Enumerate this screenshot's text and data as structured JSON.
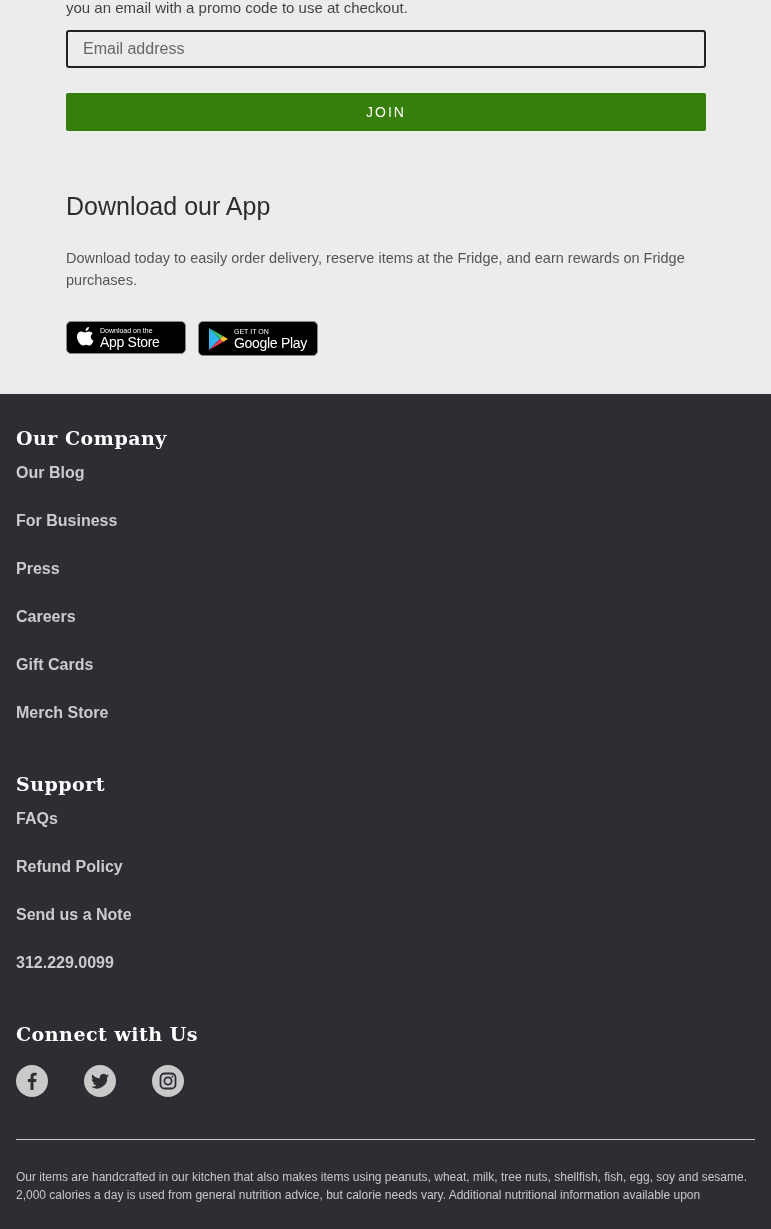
{
  "newsletter": {
    "intro": "you an email with a promo code to use at checkout.",
    "email_placeholder": "Email address",
    "button": "JOIN"
  },
  "app": {
    "title": "Download our App",
    "description": "Download today to easily order delivery, reserve items at the Fridge, and earn rewards on Fridge purchases.",
    "badges": [
      {
        "kind": "apple",
        "small": "Download on the",
        "large": "App Store"
      },
      {
        "kind": "google",
        "small": "GET IT ON",
        "large": "Google Play"
      }
    ]
  },
  "footer": {
    "sections": [
      {
        "title": "Our Company",
        "links": [
          "Our Blog",
          "For Business",
          "Press",
          "Careers",
          "Gift Cards",
          "Merch Store"
        ]
      },
      {
        "title": "Support",
        "links": [
          "FAQs",
          "Refund Policy",
          "Send us a Note",
          "312.229.0099"
        ]
      }
    ],
    "connect_title": "Connect with Us",
    "social": [
      {
        "kind": "facebook"
      },
      {
        "kind": "twitter"
      },
      {
        "kind": "instagram"
      }
    ],
    "disclaimer": "Our items are handcrafted in our kitchen that also makes items using peanuts, wheat, milk, tree nuts, shellfish, fish, egg, soy and sesame. 2,000 calories a day is used from general nutrition advice, but calorie needs vary. Additional nutritional information available upon"
  }
}
